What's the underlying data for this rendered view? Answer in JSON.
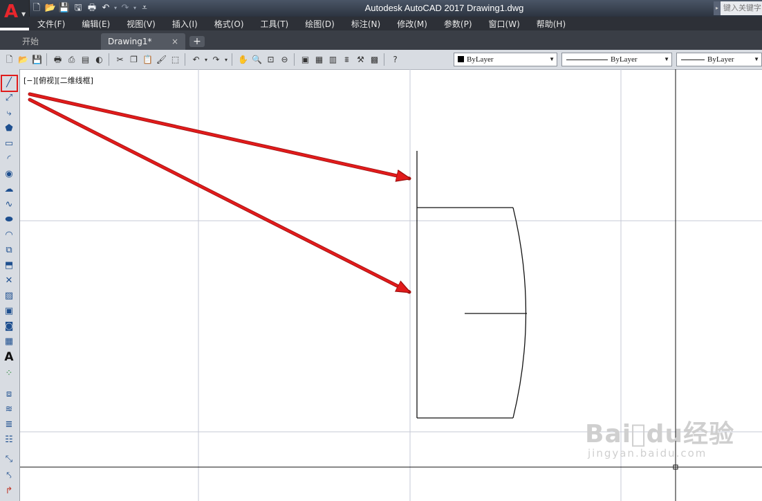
{
  "app": {
    "title": "Autodesk AutoCAD 2017    Drawing1.dwg",
    "logo_letter": "A",
    "search_placeholder": "键入关键字"
  },
  "menu": [
    "文件(F)",
    "编辑(E)",
    "视图(V)",
    "插入(I)",
    "格式(O)",
    "工具(T)",
    "绘图(D)",
    "标注(N)",
    "修改(M)",
    "参数(P)",
    "窗口(W)",
    "帮助(H)"
  ],
  "tabs": {
    "start": "开始",
    "drawing": "Drawing1*",
    "close": "×",
    "add": "+"
  },
  "properties": {
    "color": "ByLayer",
    "linetype": "ByLayer",
    "lineweight": "ByLayer"
  },
  "viewport_label": "[−][俯视][二维线框]",
  "watermark": {
    "brand": "Bai⃝du经验",
    "site": "jingyan.baidu.com"
  },
  "colors": {
    "accent_red": "#e11b1b",
    "canvas": "#ffffff",
    "titlebar": "#2c3440"
  }
}
